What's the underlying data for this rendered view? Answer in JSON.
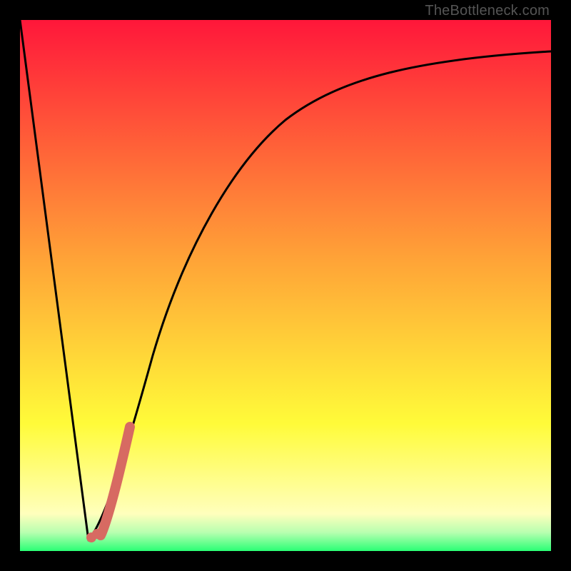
{
  "watermark": "TheBottleneck.com",
  "colors": {
    "red": "#ff173a",
    "orange": "#ffa337",
    "yellow": "#fffb39",
    "pale_yellow": "#ffffbc",
    "green": "#2aff75",
    "curve": "#000000",
    "thick_segment": "#d76a62",
    "background": "#000000"
  },
  "chart_data": {
    "type": "line",
    "title": "",
    "xlabel": "",
    "ylabel": "",
    "x": [
      0,
      0.13,
      0.16,
      0.25,
      0.35,
      0.45,
      0.55,
      0.65,
      0.75,
      0.85,
      0.95,
      1.0
    ],
    "values": [
      1.0,
      0.02,
      0.06,
      0.37,
      0.59,
      0.73,
      0.82,
      0.87,
      0.9,
      0.92,
      0.935,
      0.94
    ],
    "xlim": [
      0,
      1
    ],
    "ylim": [
      0,
      1
    ],
    "annotations": {
      "thick_segment_x_range": [
        0.155,
        0.205
      ],
      "thick_segment_y_range": [
        0.03,
        0.24
      ],
      "minimum_x": 0.13,
      "minimum_y": 0.02
    }
  }
}
